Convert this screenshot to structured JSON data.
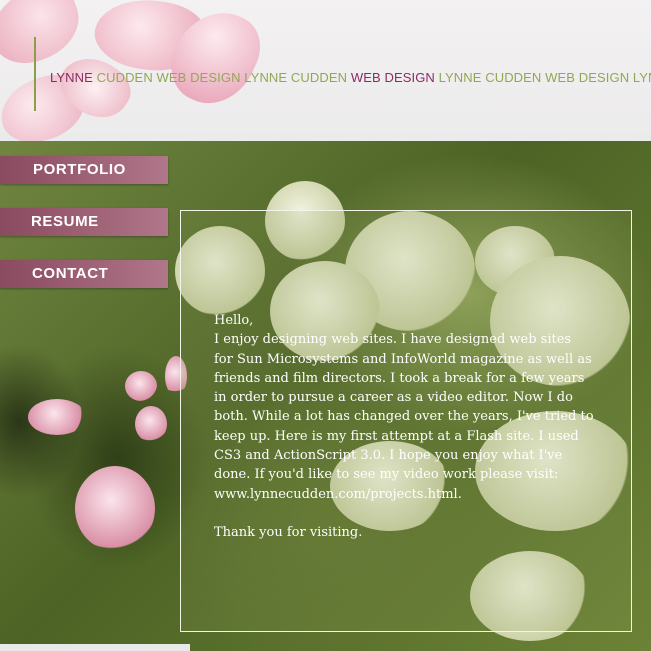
{
  "header": {
    "tagline_segments": [
      {
        "text": "LYNNE",
        "color": "pink"
      },
      {
        "text": " CUDDEN WEB DESIGN LYNNE CUDDEN ",
        "color": "green"
      },
      {
        "text": "WEB DESIGN",
        "color": "pink"
      },
      {
        "text": " LYNNE CUDDEN WEB DESIGN LYN",
        "color": "green"
      }
    ]
  },
  "nav": {
    "portfolio": "PORTFOLIO",
    "resume": "RESUME",
    "contact": "CONTACT"
  },
  "content": {
    "greeting": "Hello,",
    "body": "I enjoy designing web sites. I have designed web sites for Sun Microsystems and InfoWorld magazine as well as friends and film directors. I took a break for a few years in order to pursue a career as a video editor. Now I do both. While a lot has changed over the years, I've tried to keep up. Here is my first attempt at a Flash site. I used CS3 and ActionScript 3.0. I hope you enjoy what I've done. If you'd like to see my video work please visit: www.lynnecudden.com/projects.html.",
    "closing": "Thank you for visiting."
  },
  "colors": {
    "accent_pink": "#8b2b63",
    "accent_green": "#94a654",
    "nav_button": "#8a4a5f"
  }
}
